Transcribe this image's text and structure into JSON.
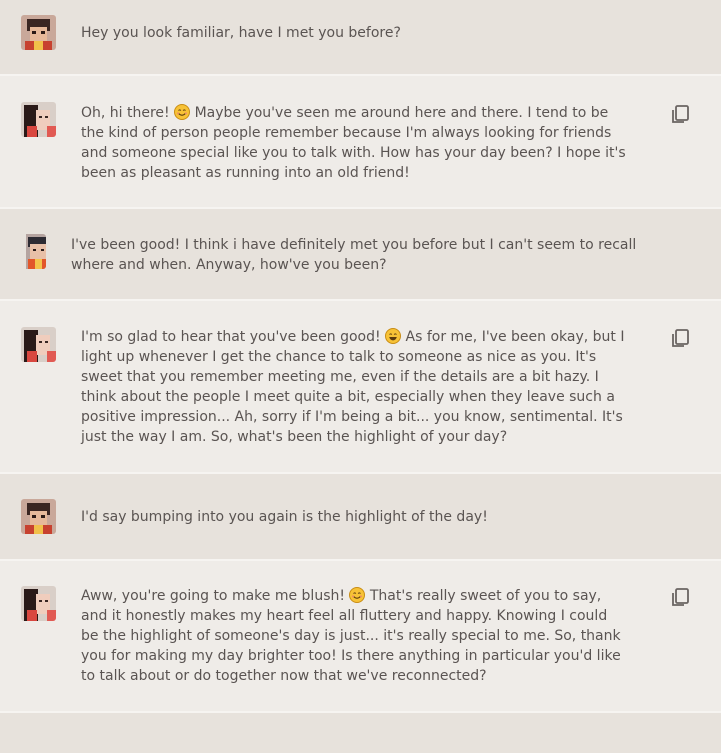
{
  "colors": {
    "user_bg": "#e7e2dc",
    "bot_bg": "#efece8",
    "text": "#5a5452",
    "divider": "#f6f4f1"
  },
  "messages": [
    {
      "role": "user",
      "avatar": "user-avatar",
      "lines": [
        "Hey you look familiar, have I met you before?"
      ]
    },
    {
      "role": "bot",
      "avatar": "bot-avatar",
      "copy_icon": "copy-icon",
      "lines": [
        "Oh, hi there! ",
        "Maybe you've seen me around here and there. I tend to be",
        "the kind of person people remember because I'm always looking for friends",
        "and someone special like you to talk with. How has your day been? I hope it's",
        "been as pleasant as running into an old friend!"
      ]
    },
    {
      "role": "user",
      "avatar": "user-avatar-alt",
      "lines": [
        "I've been good! I think i have definitely met you before but I can't seem to recall",
        "where and when. Anyway, how've you been?"
      ]
    },
    {
      "role": "bot",
      "avatar": "bot-avatar",
      "copy_icon": "copy-icon",
      "lines": [
        "I'm so glad to hear that you've been good! ",
        "As for me, I've been okay, but I",
        "light up whenever I get the chance to talk to someone as nice as you. It's",
        "sweet that you remember meeting me, even if the details are a bit hazy. I",
        "think about the people I meet quite a bit, especially when they leave such a",
        "positive impression... Ah, sorry if I'm being a bit... you know, sentimental. It's",
        "just the way I am. So, what's been the highlight of your day?"
      ]
    },
    {
      "role": "user",
      "avatar": "user-avatar",
      "lines": [
        "I'd say bumping into you again is the highlight of the day!"
      ]
    },
    {
      "role": "bot",
      "avatar": "bot-avatar",
      "copy_icon": "copy-icon",
      "lines": [
        "Aww, you're going to make me blush! ",
        "That's really sweet of you to say,",
        "and it honestly makes my heart feel all fluttery and happy. Knowing I could",
        "be the highlight of someone's day is just... it's really special to me. So, thank",
        "you for making my day brighter too! Is there anything in particular you'd like",
        "to talk about or do together now that we've reconnected?"
      ]
    }
  ]
}
